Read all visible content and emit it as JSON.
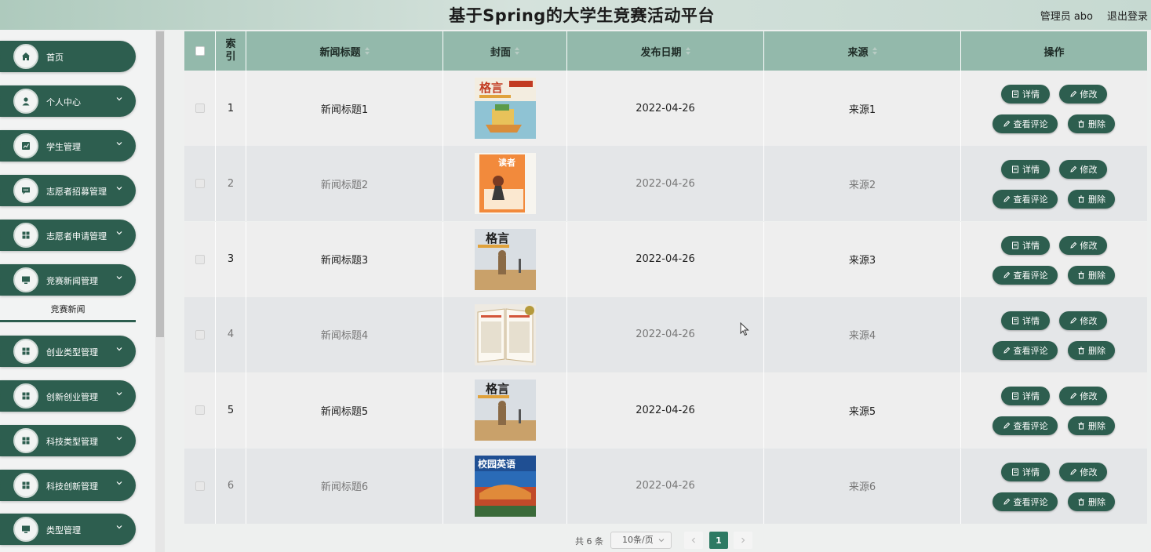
{
  "header": {
    "title": "基于Spring的大学生竞赛活动平台",
    "user": "管理员 abo",
    "logout": "退出登录"
  },
  "sidebar": {
    "items": [
      {
        "label": "首页",
        "icon": "home-icon",
        "has_chevron": false
      },
      {
        "label": "个人中心",
        "icon": "user-icon",
        "has_chevron": true
      },
      {
        "label": "学生管理",
        "icon": "chart-icon",
        "has_chevron": true
      },
      {
        "label": "志愿者招募管理",
        "icon": "chat-icon",
        "has_chevron": true
      },
      {
        "label": "志愿者申请管理",
        "icon": "grid-icon",
        "has_chevron": true
      },
      {
        "label": "竞赛新闻管理",
        "icon": "monitor-icon",
        "has_chevron": true
      },
      {
        "label": "创业类型管理",
        "icon": "grid-icon",
        "has_chevron": true
      },
      {
        "label": "创新创业管理",
        "icon": "grid-icon",
        "has_chevron": true
      },
      {
        "label": "科技类型管理",
        "icon": "grid-icon",
        "has_chevron": true
      },
      {
        "label": "科技创新管理",
        "icon": "grid-icon",
        "has_chevron": true
      },
      {
        "label": "类型管理",
        "icon": "monitor-icon",
        "has_chevron": true
      }
    ],
    "submenu": {
      "label": "竞赛新闻"
    }
  },
  "table": {
    "columns": {
      "index": "索引",
      "title": "新闻标题",
      "cover": "封面",
      "date": "发布日期",
      "source": "来源",
      "actions": "操作"
    },
    "rows": [
      {
        "index": "1",
        "title": "新闻标题1",
        "date": "2022-04-26",
        "source": "来源1",
        "cover_style": "geyan-boat"
      },
      {
        "index": "2",
        "title": "新闻标题2",
        "date": "2022-04-26",
        "source": "来源2",
        "cover_style": "duzhe"
      },
      {
        "index": "3",
        "title": "新闻标题3",
        "date": "2022-04-26",
        "source": "来源3",
        "cover_style": "geyan-statue"
      },
      {
        "index": "4",
        "title": "新闻标题4",
        "date": "2022-04-26",
        "source": "来源4",
        "cover_style": "open-book"
      },
      {
        "index": "5",
        "title": "新闻标题5",
        "date": "2022-04-26",
        "source": "来源5",
        "cover_style": "geyan-statue"
      },
      {
        "index": "6",
        "title": "新闻标题6",
        "date": "2022-04-26",
        "source": "来源6",
        "cover_style": "campus-english"
      }
    ],
    "actions": {
      "detail": "详情",
      "edit": "修改",
      "comments": "查看评论",
      "delete": "删除"
    }
  },
  "pagination": {
    "total": "共 6 条",
    "page_size": "10条/页",
    "current_page": "1"
  },
  "colors": {
    "primary": "#2d5e4f",
    "header_row": "#93b9ab",
    "accent": "#2d7a63"
  }
}
